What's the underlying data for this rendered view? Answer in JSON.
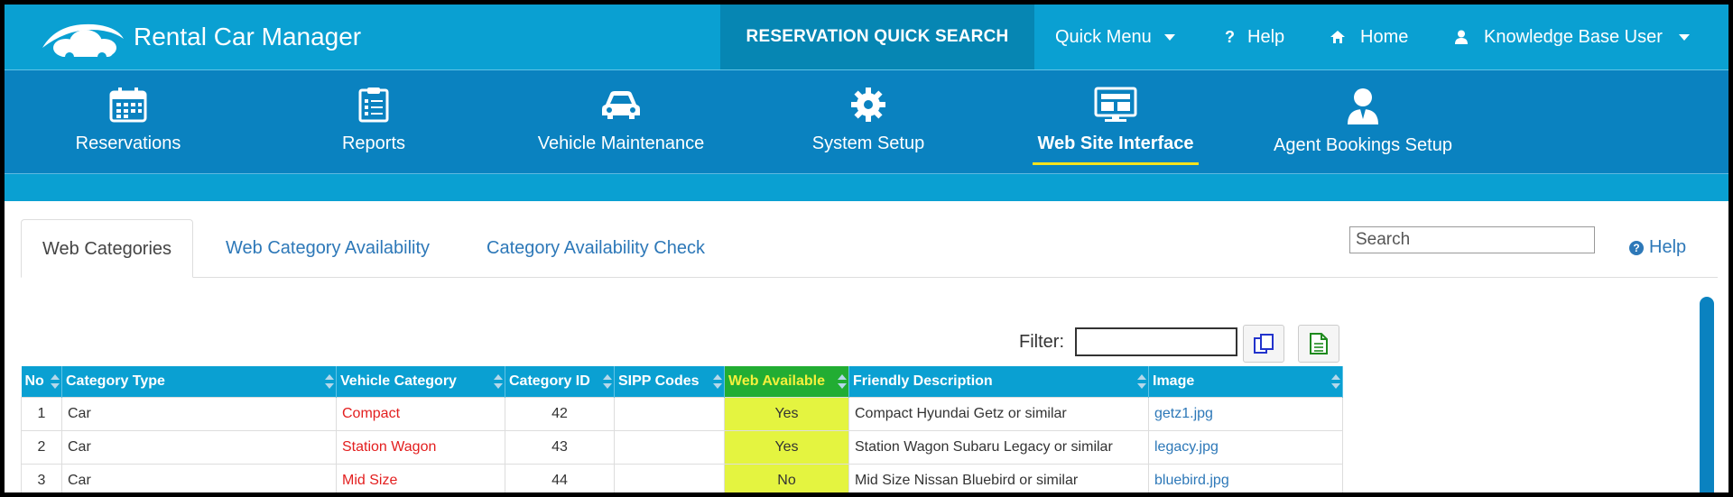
{
  "app": {
    "title": "Rental Car Manager"
  },
  "topbar": {
    "quick_search": "RESERVATION QUICK SEARCH",
    "quick_menu": "Quick Menu",
    "help": "Help",
    "home": "Home",
    "user": "Knowledge Base User"
  },
  "mainnav": [
    {
      "label": "Reservations",
      "icon": "calendar-icon"
    },
    {
      "label": "Reports",
      "icon": "clipboard-icon"
    },
    {
      "label": "Vehicle Maintenance",
      "icon": "car-icon"
    },
    {
      "label": "System Setup",
      "icon": "gear-icon"
    },
    {
      "label": "Web Site Interface",
      "icon": "monitor-icon",
      "active": true
    },
    {
      "label": "Agent Bookings Setup",
      "icon": "agent-icon"
    }
  ],
  "tabs": [
    {
      "label": "Web Categories",
      "active": true
    },
    {
      "label": "Web Category Availability"
    },
    {
      "label": "Category Availability Check"
    }
  ],
  "search": {
    "placeholder": "Search"
  },
  "help_link": "Help",
  "filter": {
    "label": "Filter:",
    "value": ""
  },
  "table": {
    "columns": [
      "No",
      "Category Type",
      "Vehicle Category",
      "Category ID",
      "SIPP Codes",
      "Web Available",
      "Friendly Description",
      "Image"
    ],
    "rows": [
      {
        "no": "1",
        "type": "Car",
        "vehicle": "Compact",
        "id": "42",
        "sipp": "",
        "web": "Yes",
        "desc": "Compact Hyundai Getz or similar",
        "image": "getz1.jpg"
      },
      {
        "no": "2",
        "type": "Car",
        "vehicle": "Station Wagon",
        "id": "43",
        "sipp": "",
        "web": "Yes",
        "desc": "Station Wagon Subaru Legacy or similar",
        "image": "legacy.jpg"
      },
      {
        "no": "3",
        "type": "Car",
        "vehicle": "Mid Size",
        "id": "44",
        "sipp": "",
        "web": "No",
        "desc": "Mid Size Nissan Bluebird or similar",
        "image": "bluebird.jpg"
      }
    ]
  },
  "colors": {
    "topbar": "#0aa0d2",
    "mainnav": "#0a82c0",
    "quick_search_bg": "#0686b3",
    "highlight_col": "#e4f440",
    "active_underline": "#f5e21c",
    "link": "#2d78b8",
    "vehicle_red": "#e31e1e"
  }
}
